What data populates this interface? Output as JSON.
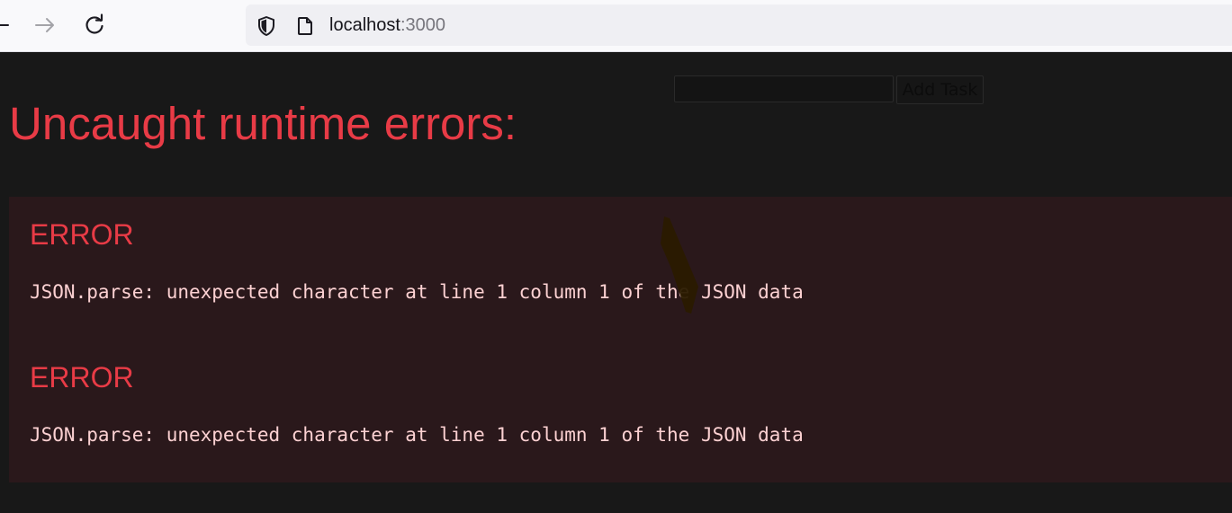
{
  "browser": {
    "url_host": "localhost",
    "url_port": ":3000"
  },
  "page": {
    "add_task_label": "Add Task",
    "task_input_value": ""
  },
  "overlay": {
    "title": "Uncaught runtime errors:",
    "errors": [
      {
        "label": "ERROR",
        "message": "JSON.parse: unexpected character at line 1 column 1 of the JSON data"
      },
      {
        "label": "ERROR",
        "message": "JSON.parse: unexpected character at line 1 column 1 of the JSON data"
      }
    ]
  },
  "colors": {
    "page_background": "#181818",
    "error_red": "#e83b46",
    "error_panel_background": "#2a181b",
    "error_message_text": "#fcd1d2",
    "toolbar_background": "#f9f9fb",
    "urlbar_background": "#efeff3"
  },
  "icons": [
    "back-arrow-icon",
    "forward-arrow-icon",
    "reload-icon",
    "shield-icon",
    "page-icon"
  ]
}
